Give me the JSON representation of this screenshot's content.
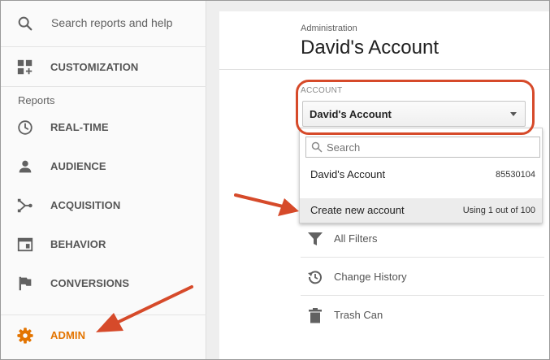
{
  "sidebar": {
    "search_label": "Search reports and help",
    "customization_label": "CUSTOMIZATION",
    "section_title": "Reports",
    "items": [
      {
        "label": "REAL-TIME",
        "icon": "clock-icon"
      },
      {
        "label": "AUDIENCE",
        "icon": "person-icon"
      },
      {
        "label": "ACQUISITION",
        "icon": "acquisition-icon"
      },
      {
        "label": "BEHAVIOR",
        "icon": "behavior-icon"
      },
      {
        "label": "CONVERSIONS",
        "icon": "flag-icon"
      }
    ],
    "admin_label": "ADMIN"
  },
  "header": {
    "breadcrumb": "Administration",
    "title": "David's Account"
  },
  "account": {
    "label": "ACCOUNT",
    "selected": "David's Account"
  },
  "dropdown": {
    "search_placeholder": "Search",
    "account_name": "David's Account",
    "account_id": "85530104",
    "create_label": "Create new account",
    "usage": "Using 1 out of 100"
  },
  "admin_list": {
    "items": [
      {
        "label": "All Filters",
        "icon": "filter-icon"
      },
      {
        "label": "Change History",
        "icon": "history-icon"
      },
      {
        "label": "Trash Can",
        "icon": "trash-icon"
      }
    ]
  },
  "colors": {
    "accent": "#e37400",
    "annotation": "#d64a2a"
  }
}
